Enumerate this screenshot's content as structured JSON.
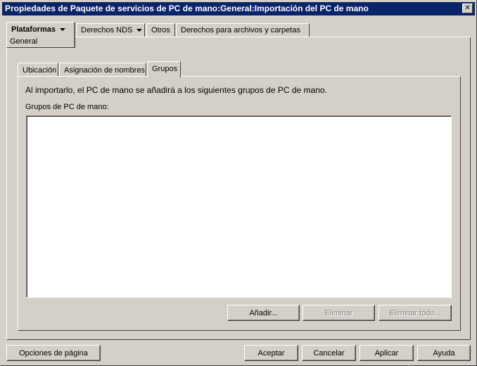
{
  "window": {
    "title": "Propiedades de Paquete de servicios de PC de mano:General:Importación del PC  de mano",
    "close_glyph": "✕"
  },
  "top_tabs": [
    {
      "label": "Plataformas",
      "has_dropdown": true,
      "selected": true,
      "sublabel": "General"
    },
    {
      "label": "Derechos NDS",
      "has_dropdown": true,
      "selected": false
    },
    {
      "label": "Otros",
      "has_dropdown": false,
      "selected": false
    },
    {
      "label": "Derechos para archivos y carpetas",
      "has_dropdown": false,
      "selected": false
    }
  ],
  "inner_tabs": [
    {
      "label": "Ubicación",
      "selected": false
    },
    {
      "label": "Asignación de nombres",
      "selected": false
    },
    {
      "label": "Grupos",
      "selected": true
    }
  ],
  "groups_page": {
    "description": "Al importarlo, el PC de mano se añadirá a los siguientes grupos de PC de mano.",
    "list_label": "Grupos de PC de mano:",
    "items": [],
    "add_label": "Añadir...",
    "remove_label": "Eliminar",
    "remove_all_label": "Eliminar todo..."
  },
  "footer": {
    "page_options_label": "Opciones de página",
    "ok_label": "Aceptar",
    "cancel_label": "Cancelar",
    "apply_label": "Aplicar",
    "help_label": "Ayuda"
  },
  "colors": {
    "titlebar": "#0a246a",
    "face": "#d4d0c8",
    "list_bg": "#ffffff",
    "disabled_text": "#808080"
  }
}
